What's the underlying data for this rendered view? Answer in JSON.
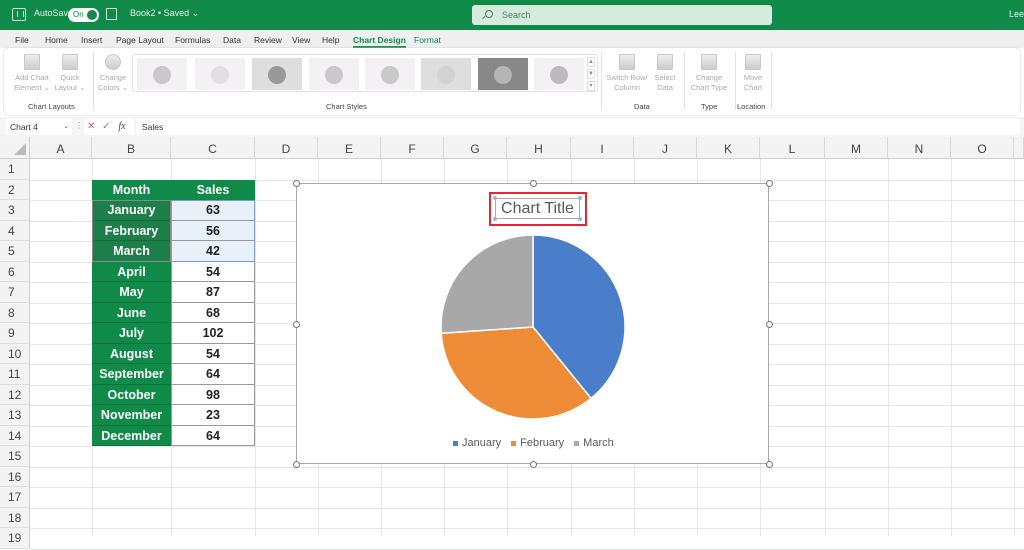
{
  "titlebar": {
    "autosave_label": "AutoSave",
    "autosave_state": "On",
    "doc_title": "Book2 • Saved ⌄",
    "search_placeholder": "Search",
    "user_partial": "Lee"
  },
  "menu": {
    "items": [
      "File",
      "Home",
      "Insert",
      "Page Layout",
      "Formulas",
      "Data",
      "Review",
      "View",
      "Help",
      "Chart Design",
      "Format"
    ],
    "active": "Chart Design"
  },
  "ribbon": {
    "add_chart_element": "Add Chart\nElement ⌄",
    "add_chart_element_l1": "Add Chart",
    "add_chart_element_l2": "Element ⌄",
    "quick_layout_l1": "Quick",
    "quick_layout_l2": "Layout ⌄",
    "change_colors_l1": "Change",
    "change_colors_l2": "Colors ⌄",
    "switch_row_col_l1": "Switch Row/",
    "switch_row_col_l2": "Column",
    "select_data_l1": "Select",
    "select_data_l2": "Data",
    "change_chart_type_l1": "Change",
    "change_chart_type_l2": "Chart Type",
    "move_chart_l1": "Move",
    "move_chart_l2": "Chart",
    "groups": {
      "chart_layouts": "Chart Layouts",
      "chart_styles": "Chart Styles",
      "data": "Data",
      "type": "Type",
      "location": "Location"
    },
    "style_count": 8,
    "selected_style": 7
  },
  "formula_bar": {
    "name_box": "Chart 4",
    "cancel": "✕",
    "enter": "✓",
    "fx": "fx",
    "value": "Sales"
  },
  "grid": {
    "columns": [
      "A",
      "B",
      "C",
      "D",
      "E",
      "F",
      "G",
      "H",
      "I",
      "J",
      "K",
      "L",
      "M",
      "N",
      "O"
    ],
    "rows": [
      "1",
      "2",
      "3",
      "4",
      "5",
      "6",
      "7",
      "8",
      "9",
      "10",
      "11",
      "12",
      "13",
      "14",
      "15",
      "16",
      "17",
      "18",
      "19"
    ],
    "table": {
      "headers": [
        "Month",
        "Sales"
      ],
      "rows": [
        [
          "January",
          "63"
        ],
        [
          "February",
          "56"
        ],
        [
          "March",
          "42"
        ],
        [
          "April",
          "54"
        ],
        [
          "May",
          "87"
        ],
        [
          "June",
          "68"
        ],
        [
          "July",
          "102"
        ],
        [
          "August",
          "54"
        ],
        [
          "September",
          "64"
        ],
        [
          "October",
          "98"
        ],
        [
          "November",
          "23"
        ],
        [
          "December",
          "64"
        ]
      ]
    }
  },
  "chart": {
    "title": "Chart Title",
    "colors": {
      "January": "#4a7ecb",
      "February": "#ed8b36",
      "March": "#a8a8a8"
    }
  },
  "chart_data": {
    "type": "pie",
    "title": "Chart Title",
    "categories": [
      "January",
      "February",
      "March"
    ],
    "values": [
      63,
      56,
      42
    ],
    "legend": "bottom"
  },
  "colors": {
    "brand": "#108a49",
    "selection_highlight": "#e8262e"
  }
}
